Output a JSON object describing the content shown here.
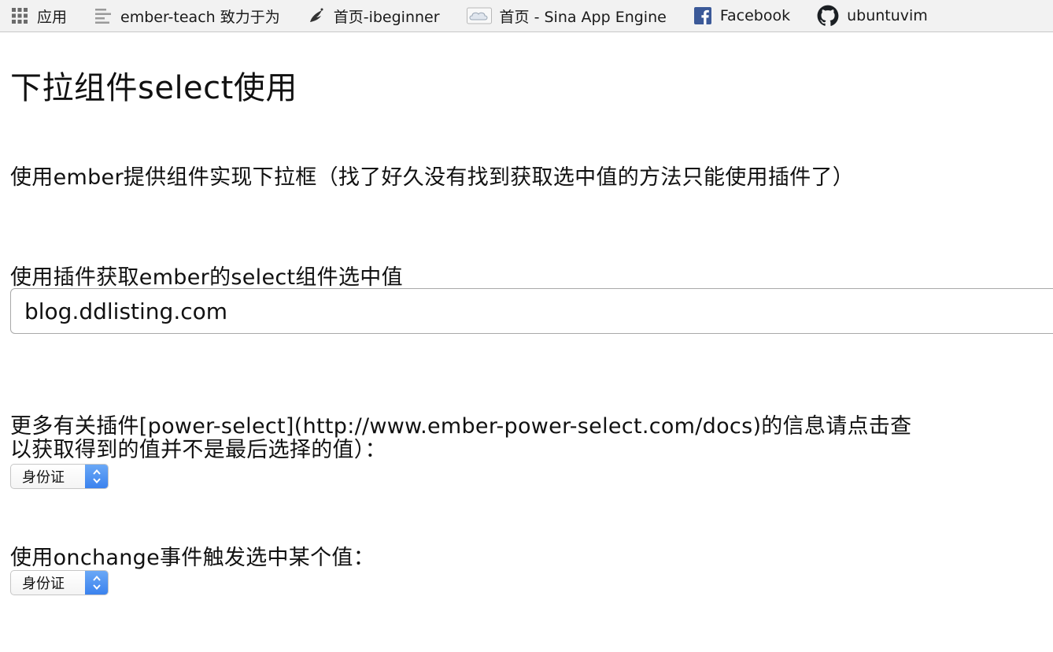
{
  "bookmarks": [
    {
      "label": "应用",
      "icon": "apps-grid-icon"
    },
    {
      "label": "ember-teach  致力于为",
      "icon": "document-list-icon"
    },
    {
      "label": "首页-ibeginner",
      "icon": "bird-logo-icon"
    },
    {
      "label": "首页 - Sina App Engine",
      "icon": "cloud-icon"
    },
    {
      "label": "Facebook",
      "icon": "facebook-icon"
    },
    {
      "label": "ubuntuvim",
      "icon": "github-icon"
    }
  ],
  "page": {
    "title": "下拉组件select使用",
    "intro": "使用ember提供组件实现下拉框（找了好久没有找到获取选中值的方法只能使用插件了）",
    "plugin_heading": "使用插件获取ember的select组件选中值",
    "plugin_input_value": "blog.ddlisting.com",
    "more_info_line1": "更多有关插件[power-select](http://www.ember-power-select.com/docs)的信息请点击查",
    "more_info_line2": "以获取得到的值并不是最后选择的值）：",
    "select1_value": "身份证",
    "onchange_heading": "使用onchange事件触发选中某个值：",
    "select2_value": "身份证"
  },
  "colors": {
    "select_arrow_bg": "#3b82ee",
    "facebook_blue": "#3b5998"
  }
}
